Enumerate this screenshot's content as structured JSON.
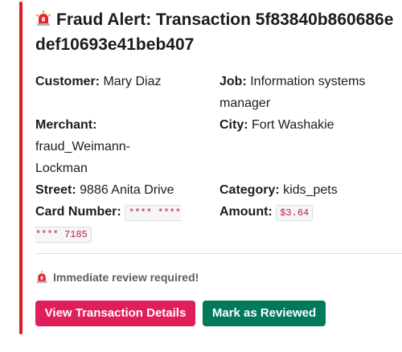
{
  "alert": {
    "icon": "rotating-light-icon",
    "title": "Fraud Alert: Transaction 5f83840b860686edef10693e41beb407"
  },
  "fields": {
    "customer_label": "Customer:",
    "customer_value": "Mary Diaz",
    "job_label": "Job:",
    "job_value": "Information systems manager",
    "merchant_label": "Merchant:",
    "merchant_value": "fraud_Weimann-Lockman",
    "city_label": "City:",
    "city_value": "Fort Washakie",
    "street_label": "Street:",
    "street_value": "9886 Anita Drive",
    "category_label": "Category:",
    "category_value": "kids_pets",
    "card_label": "Card Number:",
    "card_value": "**** **** **** 7185",
    "amount_label": "Amount:",
    "amount_value": "$3.64"
  },
  "review_note": "Immediate review required!",
  "buttons": {
    "view_details": "View Transaction Details",
    "mark_reviewed": "Mark as Reviewed"
  },
  "colors": {
    "accent": "#e01e1e",
    "danger_button": "#e01e5a",
    "primary_button": "#007a5a"
  }
}
